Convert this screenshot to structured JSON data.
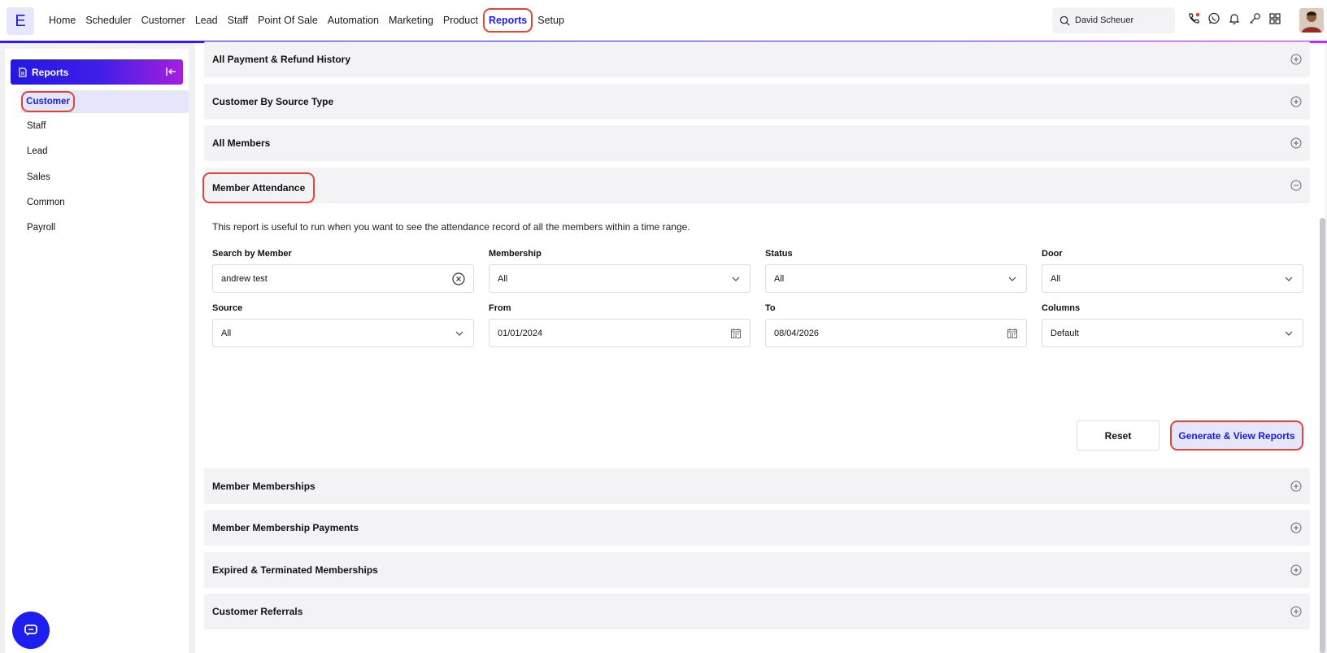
{
  "app": {
    "logo_letter": "E"
  },
  "nav": {
    "items": [
      "Home",
      "Scheduler",
      "Customer",
      "Lead",
      "Staff",
      "Point Of Sale",
      "Automation",
      "Marketing",
      "Product",
      "Reports",
      "Setup"
    ],
    "active": "Reports"
  },
  "search": {
    "value": "David Scheuer"
  },
  "top_icons": [
    "phone-icon",
    "whatsapp-icon",
    "bell-icon",
    "key-icon",
    "grid-icon"
  ],
  "sidebar": {
    "header": "Reports",
    "items": [
      "Customer",
      "Staff",
      "Lead",
      "Sales",
      "Common",
      "Payroll"
    ],
    "active": "Customer"
  },
  "accordions": {
    "payment_history": "All Payment & Refund History",
    "by_source": "Customer By Source Type",
    "all_members": "All Members",
    "member_attendance": "Member Attendance",
    "member_memberships": "Member Memberships",
    "membership_payments": "Member Membership Payments",
    "expired_terminated": "Expired & Terminated Memberships",
    "referrals": "Customer Referrals"
  },
  "attendance": {
    "description": "This report is useful to run when you want to see the attendance record of all the members within a time range.",
    "search_by_member": {
      "label": "Search by Member",
      "value": "andrew test"
    },
    "membership": {
      "label": "Membership",
      "value": "All"
    },
    "status": {
      "label": "Status",
      "value": "All"
    },
    "door": {
      "label": "Door",
      "value": "All"
    },
    "source": {
      "label": "Source",
      "value": "All"
    },
    "from": {
      "label": "From",
      "value": "01/01/2024"
    },
    "to": {
      "label": "To",
      "value": "08/04/2026"
    },
    "columns": {
      "label": "Columns",
      "value": "Default"
    },
    "reset_label": "Reset",
    "generate_label": "Generate & View Reports"
  },
  "colors": {
    "accent": "#1e1ee0",
    "highlight": "#e0453a",
    "panel": "#f3f3f5"
  }
}
